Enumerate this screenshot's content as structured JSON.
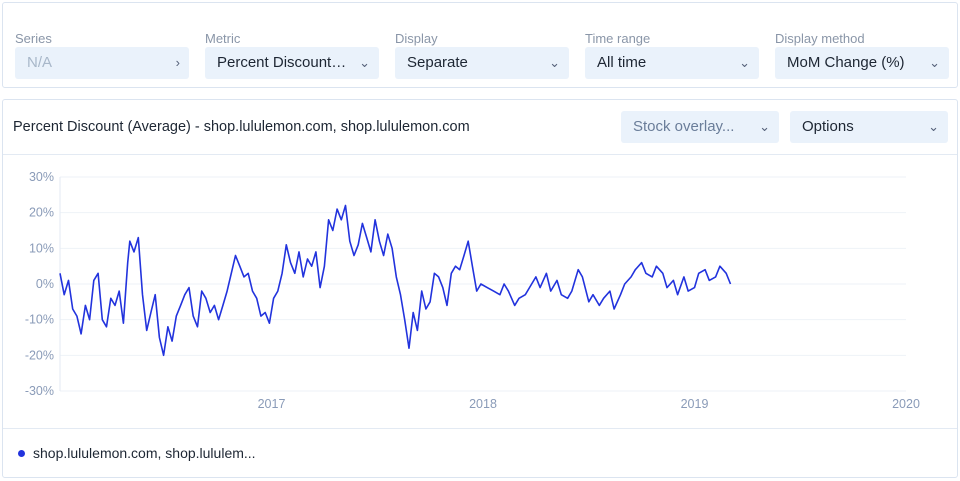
{
  "controls": {
    "series": {
      "label": "Series",
      "value": "N/A",
      "icon": "chevron-right-icon"
    },
    "metric": {
      "label": "Metric",
      "value": "Percent Discount (av...",
      "icon": "chevron-down-icon"
    },
    "display": {
      "label": "Display",
      "value": "Separate",
      "icon": "chevron-down-icon"
    },
    "time_range": {
      "label": "Time range",
      "value": "All time",
      "icon": "chevron-down-icon"
    },
    "display_method": {
      "label": "Display method",
      "value": "MoM Change (%)",
      "icon": "chevron-down-icon"
    }
  },
  "panel": {
    "title": "Percent Discount (Average) - shop.lululemon.com, shop.lululemon.com",
    "stock_overlay": "Stock overlay...",
    "options": "Options",
    "legend_label": "shop.lululemon.com, shop.lululem...",
    "series_color": "#2233dd"
  },
  "chart_data": {
    "type": "line",
    "ylim": [
      -30,
      30
    ],
    "yticks": [
      30,
      20,
      10,
      0,
      -10,
      -20,
      -30
    ],
    "ytick_labels": [
      "30%",
      "20%",
      "10%",
      "0%",
      "-10%",
      "-20%",
      "-30%"
    ],
    "xlim": [
      2016.0,
      2020.0
    ],
    "xticks": [
      2017,
      2018,
      2019,
      2020
    ],
    "xtick_labels": [
      "2017",
      "2018",
      "2019",
      "2020"
    ],
    "grid": true,
    "series": [
      {
        "color": "#2233dd",
        "points": [
          [
            2016.0,
            3
          ],
          [
            2016.02,
            -3
          ],
          [
            2016.04,
            1
          ],
          [
            2016.06,
            -7
          ],
          [
            2016.08,
            -9
          ],
          [
            2016.1,
            -14
          ],
          [
            2016.12,
            -6
          ],
          [
            2016.14,
            -10
          ],
          [
            2016.16,
            1
          ],
          [
            2016.18,
            3
          ],
          [
            2016.2,
            -10
          ],
          [
            2016.22,
            -12
          ],
          [
            2016.24,
            -4
          ],
          [
            2016.26,
            -6
          ],
          [
            2016.28,
            -2
          ],
          [
            2016.3,
            -11
          ],
          [
            2016.32,
            6
          ],
          [
            2016.33,
            12
          ],
          [
            2016.35,
            9
          ],
          [
            2016.37,
            13
          ],
          [
            2016.39,
            -3
          ],
          [
            2016.41,
            -13
          ],
          [
            2016.43,
            -8
          ],
          [
            2016.45,
            -3
          ],
          [
            2016.47,
            -15
          ],
          [
            2016.49,
            -20
          ],
          [
            2016.51,
            -12
          ],
          [
            2016.53,
            -16
          ],
          [
            2016.55,
            -9
          ],
          [
            2016.57,
            -6
          ],
          [
            2016.59,
            -3
          ],
          [
            2016.61,
            -1
          ],
          [
            2016.63,
            -9
          ],
          [
            2016.65,
            -12
          ],
          [
            2016.67,
            -2
          ],
          [
            2016.69,
            -4
          ],
          [
            2016.71,
            -8
          ],
          [
            2016.73,
            -6
          ],
          [
            2016.75,
            -10
          ],
          [
            2016.77,
            -6
          ],
          [
            2016.79,
            -2
          ],
          [
            2016.81,
            3
          ],
          [
            2016.83,
            8
          ],
          [
            2016.85,
            5
          ],
          [
            2016.87,
            2
          ],
          [
            2016.89,
            3
          ],
          [
            2016.91,
            -2
          ],
          [
            2016.93,
            -4
          ],
          [
            2016.95,
            -9
          ],
          [
            2016.97,
            -8
          ],
          [
            2016.99,
            -11
          ],
          [
            2017.01,
            -4
          ],
          [
            2017.03,
            -2
          ],
          [
            2017.05,
            3
          ],
          [
            2017.07,
            11
          ],
          [
            2017.09,
            6
          ],
          [
            2017.11,
            3
          ],
          [
            2017.13,
            9
          ],
          [
            2017.15,
            2
          ],
          [
            2017.17,
            7
          ],
          [
            2017.19,
            5
          ],
          [
            2017.21,
            9
          ],
          [
            2017.23,
            -1
          ],
          [
            2017.25,
            5
          ],
          [
            2017.27,
            18
          ],
          [
            2017.29,
            15
          ],
          [
            2017.31,
            21
          ],
          [
            2017.33,
            18
          ],
          [
            2017.35,
            22
          ],
          [
            2017.37,
            12
          ],
          [
            2017.39,
            8
          ],
          [
            2017.41,
            11
          ],
          [
            2017.43,
            17
          ],
          [
            2017.45,
            13
          ],
          [
            2017.47,
            9
          ],
          [
            2017.49,
            18
          ],
          [
            2017.51,
            12
          ],
          [
            2017.53,
            8
          ],
          [
            2017.55,
            14
          ],
          [
            2017.57,
            10
          ],
          [
            2017.59,
            2
          ],
          [
            2017.61,
            -3
          ],
          [
            2017.63,
            -10
          ],
          [
            2017.65,
            -18
          ],
          [
            2017.67,
            -8
          ],
          [
            2017.69,
            -13
          ],
          [
            2017.71,
            -2
          ],
          [
            2017.73,
            -7
          ],
          [
            2017.75,
            -5
          ],
          [
            2017.77,
            3
          ],
          [
            2017.79,
            2
          ],
          [
            2017.81,
            -1
          ],
          [
            2017.83,
            -6
          ],
          [
            2017.85,
            3
          ],
          [
            2017.87,
            5
          ],
          [
            2017.89,
            4
          ],
          [
            2017.91,
            8
          ],
          [
            2017.93,
            12
          ],
          [
            2017.95,
            5
          ],
          [
            2017.97,
            -2
          ],
          [
            2017.99,
            0
          ],
          [
            2018.02,
            -1
          ],
          [
            2018.05,
            -2
          ],
          [
            2018.08,
            -3
          ],
          [
            2018.1,
            0
          ],
          [
            2018.12,
            -2
          ],
          [
            2018.15,
            -6
          ],
          [
            2018.17,
            -4
          ],
          [
            2018.2,
            -3
          ],
          [
            2018.22,
            -1
          ],
          [
            2018.25,
            2
          ],
          [
            2018.27,
            -1
          ],
          [
            2018.3,
            3
          ],
          [
            2018.32,
            -2
          ],
          [
            2018.35,
            1
          ],
          [
            2018.37,
            -3
          ],
          [
            2018.4,
            -4
          ],
          [
            2018.42,
            -2
          ],
          [
            2018.45,
            4
          ],
          [
            2018.47,
            2
          ],
          [
            2018.5,
            -5
          ],
          [
            2018.52,
            -3
          ],
          [
            2018.55,
            -6
          ],
          [
            2018.57,
            -4
          ],
          [
            2018.6,
            -2
          ],
          [
            2018.62,
            -7
          ],
          [
            2018.65,
            -3
          ],
          [
            2018.67,
            0
          ],
          [
            2018.7,
            2
          ],
          [
            2018.72,
            4
          ],
          [
            2018.75,
            6
          ],
          [
            2018.77,
            3
          ],
          [
            2018.8,
            2
          ],
          [
            2018.82,
            5
          ],
          [
            2018.85,
            3
          ],
          [
            2018.87,
            -1
          ],
          [
            2018.9,
            1
          ],
          [
            2018.92,
            -3
          ],
          [
            2018.95,
            2
          ],
          [
            2018.97,
            -2
          ],
          [
            2019.0,
            -1
          ],
          [
            2019.02,
            3
          ],
          [
            2019.05,
            4
          ],
          [
            2019.07,
            1
          ],
          [
            2019.1,
            2
          ],
          [
            2019.12,
            5
          ],
          [
            2019.15,
            3
          ],
          [
            2019.17,
            0
          ]
        ]
      }
    ]
  }
}
